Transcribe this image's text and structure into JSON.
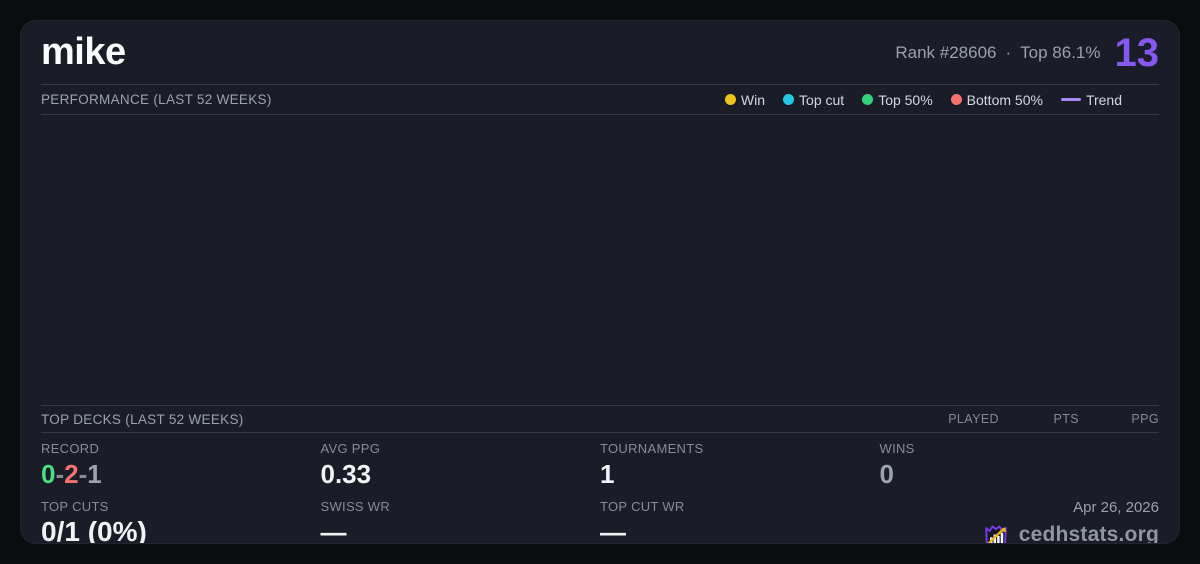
{
  "header": {
    "player_name": "mike",
    "rank_text": "Rank #28606",
    "separator": "·",
    "top_percent_text": "Top 86.1%",
    "points": "13"
  },
  "performance": {
    "title": "PERFORMANCE (LAST 52 WEEKS)",
    "legend": [
      {
        "label": "Win"
      },
      {
        "label": "Top cut"
      },
      {
        "label": "Top 50%"
      },
      {
        "label": "Bottom 50%"
      },
      {
        "label": "Trend"
      }
    ]
  },
  "top_decks": {
    "title": "TOP DECKS (LAST 52 WEEKS)",
    "columns": [
      "PLAYED",
      "PTS",
      "PPG"
    ],
    "rows": []
  },
  "stats": {
    "record": {
      "label": "RECORD",
      "wins": "0",
      "losses": "2",
      "draws": "1",
      "separator": "-"
    },
    "avg_ppg": {
      "label": "AVG PPG",
      "value": "0.33"
    },
    "tournaments": {
      "label": "TOURNAMENTS",
      "value": "1"
    },
    "wins": {
      "label": "WINS",
      "value": "0"
    },
    "top_cuts": {
      "label": "TOP CUTS",
      "value": "0/1 (0%)"
    },
    "swiss_wr": {
      "label": "SWISS WR",
      "value": "—"
    },
    "top_cut_wr": {
      "label": "TOP CUT WR",
      "value": "—"
    }
  },
  "footer": {
    "date": "Apr 26, 2026",
    "brand": "cedhstats.org"
  },
  "colors": {
    "accent_purple": "#8757f2",
    "win": "#efc319",
    "top_cut": "#25c9e3",
    "top_50": "#34d17c",
    "bottom_50": "#f87171",
    "trend": "#a78bfa",
    "record_win": "#4ade80",
    "record_loss": "#f87171",
    "record_draw": "#9ca3af",
    "logo_purple": "#7c3aed",
    "logo_gold": "#f2b b18"
  }
}
